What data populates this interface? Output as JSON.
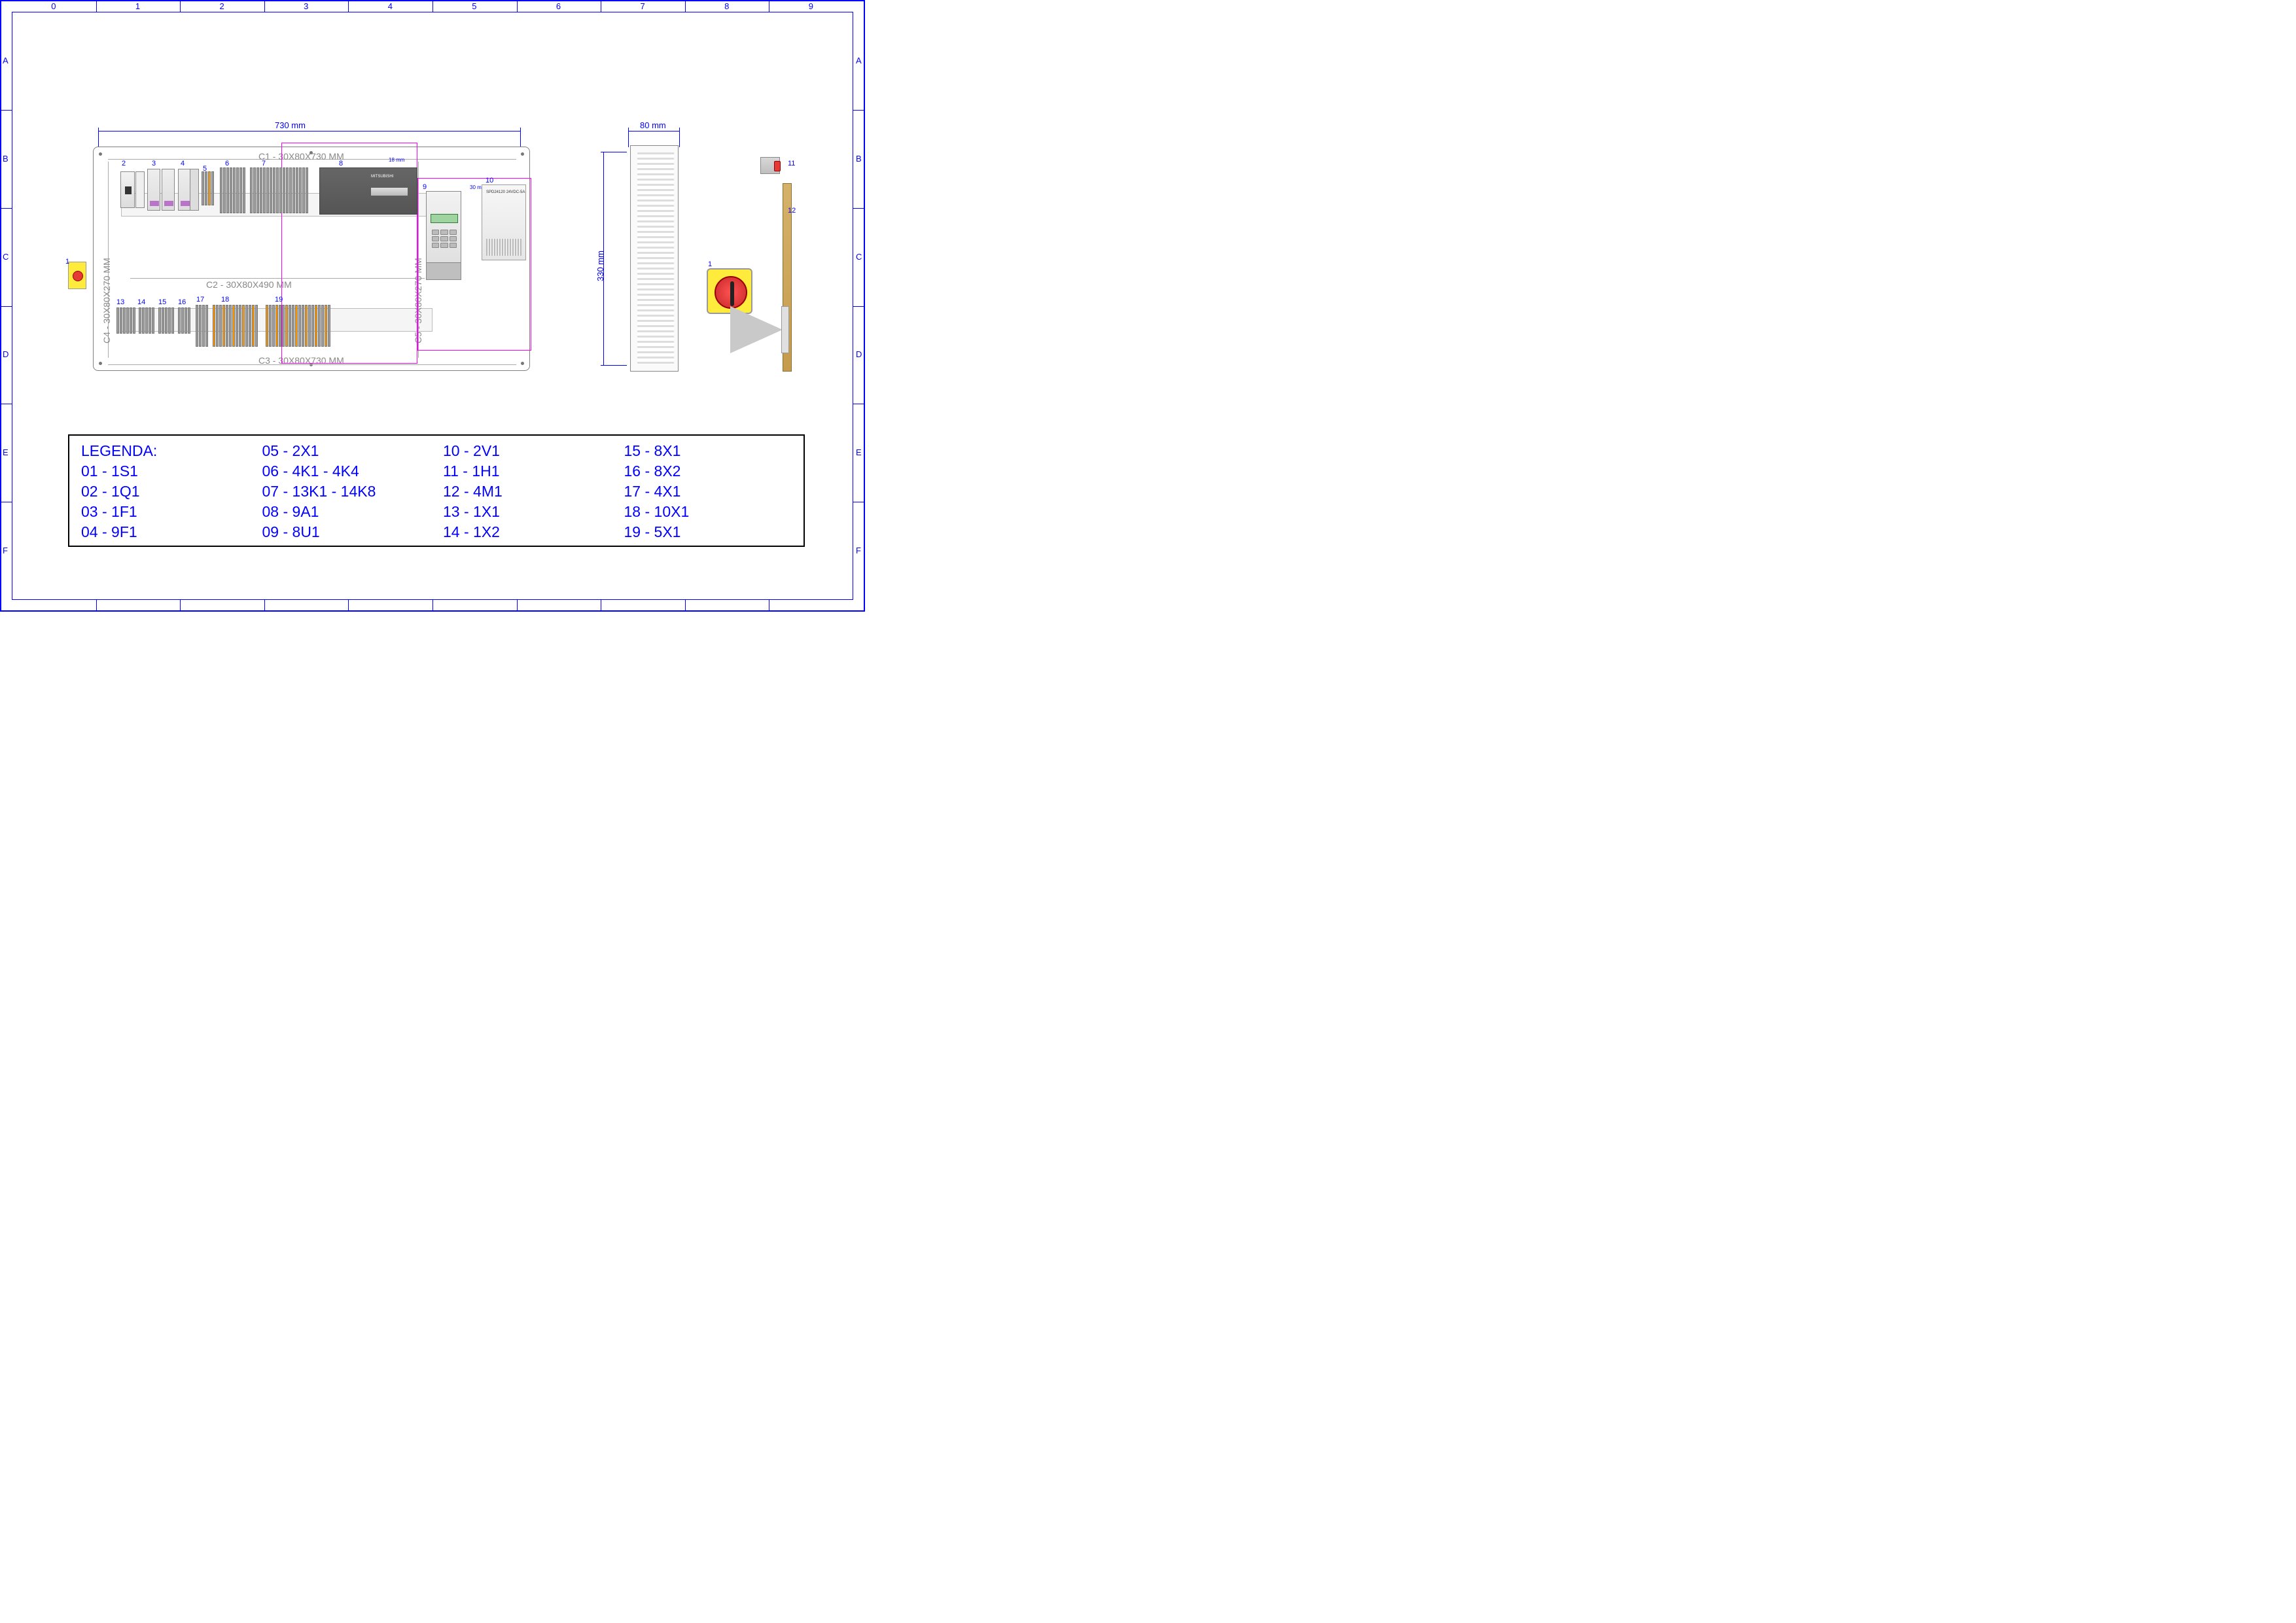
{
  "grid": {
    "cols": [
      "0",
      "1",
      "2",
      "3",
      "4",
      "5",
      "6",
      "7",
      "8",
      "9"
    ],
    "rows": [
      "A",
      "B",
      "C",
      "D",
      "E",
      "F"
    ]
  },
  "dimensions": {
    "width_label": "730 mm",
    "depth_label": "80 mm",
    "height_label": "330 mm",
    "plc_gap_label": "18 mm",
    "vfd_gap_label": "30 mm"
  },
  "rails": {
    "c1": "C1 - 30X80X730 MM",
    "c2": "C2 - 30X80X490 MM",
    "c3": "C3 - 30X80X730 MM",
    "c4": "C4 - 30X80X270 MM",
    "c5": "C5 - 30X80X270 MM"
  },
  "component_labels": {
    "n1": "1",
    "n2": "2",
    "n3": "3",
    "n4": "4",
    "n5": "5",
    "n6": "6",
    "n7": "7",
    "n8": "8",
    "n9": "9",
    "n10": "10",
    "n11": "11",
    "n12": "12",
    "n13": "13",
    "n14": "14",
    "n15": "15",
    "n16": "16",
    "n17": "17",
    "n18": "18",
    "n19": "19"
  },
  "plc_badge": "MITSUBISHI",
  "psu_model": "SPD24120  24VDC-5A",
  "legend": {
    "title": "LEGENDA:",
    "items": [
      "01 - 1S1",
      "02 - 1Q1",
      "03 - 1F1",
      "04 - 9F1",
      "05 - 2X1",
      "06 - 4K1 - 4K4",
      "07 - 13K1 - 14K8",
      "08 - 9A1",
      "09 - 8U1",
      "10 - 2V1",
      "11 - 1H1",
      "12 - 4M1",
      "13 - 1X1",
      "14 - 1X2",
      "15 - 8X1",
      "16 - 8X2",
      "17 - 4X1",
      "18 - 10X1",
      "19 - 5X1"
    ]
  }
}
